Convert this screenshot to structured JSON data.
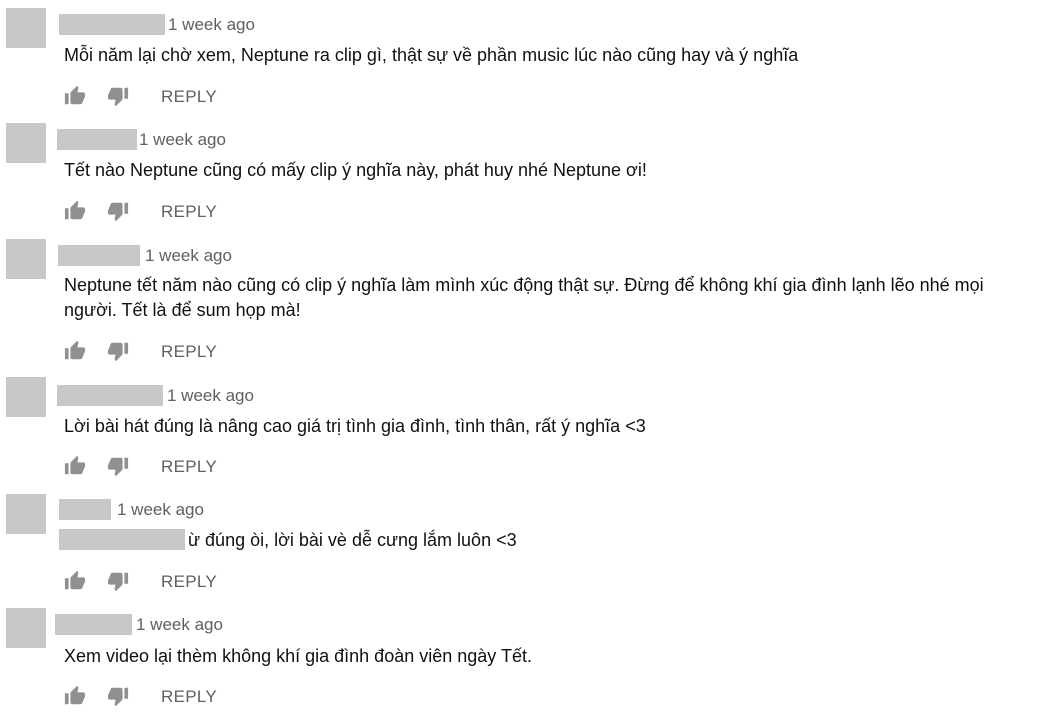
{
  "comments": [
    {
      "time": "1 week ago",
      "text": "Mỗi năm lại chờ xem, Neptune ra clip gì, thật sự về phần music lúc nào cũng hay và ý nghĩa",
      "reply_label": "REPLY"
    },
    {
      "time": "1 week ago",
      "text": "Tết nào Neptune cũng có mấy clip ý nghĩa này, phát huy nhé Neptune ơi!",
      "reply_label": "REPLY"
    },
    {
      "time": "1 week ago",
      "text": "Neptune tết năm nào cũng có clip ý nghĩa làm mình xúc động thật sự. Đừng để không khí gia đình lạnh lẽo nhé mọi người. Tết là để sum họp mà!",
      "reply_label": "REPLY"
    },
    {
      "time": "1 week ago",
      "text": "Lời bài hát đúng là nâng cao giá trị tình gia đình, tình thân, rất ý nghĩa <3",
      "reply_label": "REPLY"
    },
    {
      "time": "1 week ago",
      "text": "ừ đúng òi, lời bài vè dễ cưng lắm luôn <3",
      "reply_label": "REPLY"
    },
    {
      "time": "1 week ago",
      "text": "Xem video lại thèm không khí gia đình đoàn viên ngày Tết.",
      "reply_label": "REPLY"
    }
  ],
  "icons": {
    "like": "thumb-up-icon",
    "dislike": "thumb-down-icon"
  },
  "colors": {
    "redaction": "#c8c8c8",
    "meta_text": "#606060",
    "icon": "#909090"
  }
}
